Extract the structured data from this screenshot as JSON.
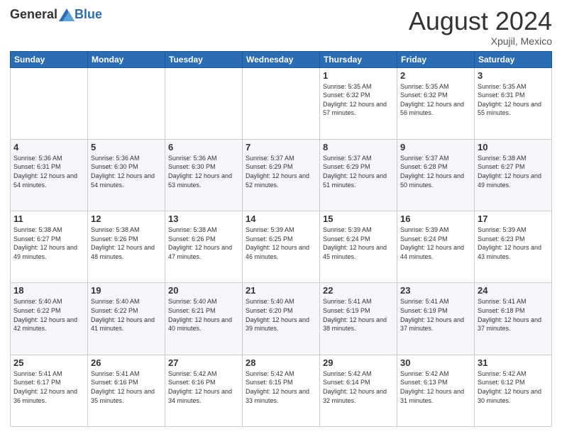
{
  "logo": {
    "general": "General",
    "blue": "Blue"
  },
  "title": "August 2024",
  "location": "Xpujil, Mexico",
  "days_of_week": [
    "Sunday",
    "Monday",
    "Tuesday",
    "Wednesday",
    "Thursday",
    "Friday",
    "Saturday"
  ],
  "weeks": [
    [
      {
        "day": "",
        "info": ""
      },
      {
        "day": "",
        "info": ""
      },
      {
        "day": "",
        "info": ""
      },
      {
        "day": "",
        "info": ""
      },
      {
        "day": "1",
        "info": "Sunrise: 5:35 AM\nSunset: 6:32 PM\nDaylight: 12 hours\nand 57 minutes."
      },
      {
        "day": "2",
        "info": "Sunrise: 5:35 AM\nSunset: 6:32 PM\nDaylight: 12 hours\nand 56 minutes."
      },
      {
        "day": "3",
        "info": "Sunrise: 5:35 AM\nSunset: 6:31 PM\nDaylight: 12 hours\nand 55 minutes."
      }
    ],
    [
      {
        "day": "4",
        "info": "Sunrise: 5:36 AM\nSunset: 6:31 PM\nDaylight: 12 hours\nand 54 minutes."
      },
      {
        "day": "5",
        "info": "Sunrise: 5:36 AM\nSunset: 6:30 PM\nDaylight: 12 hours\nand 54 minutes."
      },
      {
        "day": "6",
        "info": "Sunrise: 5:36 AM\nSunset: 6:30 PM\nDaylight: 12 hours\nand 53 minutes."
      },
      {
        "day": "7",
        "info": "Sunrise: 5:37 AM\nSunset: 6:29 PM\nDaylight: 12 hours\nand 52 minutes."
      },
      {
        "day": "8",
        "info": "Sunrise: 5:37 AM\nSunset: 6:29 PM\nDaylight: 12 hours\nand 51 minutes."
      },
      {
        "day": "9",
        "info": "Sunrise: 5:37 AM\nSunset: 6:28 PM\nDaylight: 12 hours\nand 50 minutes."
      },
      {
        "day": "10",
        "info": "Sunrise: 5:38 AM\nSunset: 6:27 PM\nDaylight: 12 hours\nand 49 minutes."
      }
    ],
    [
      {
        "day": "11",
        "info": "Sunrise: 5:38 AM\nSunset: 6:27 PM\nDaylight: 12 hours\nand 49 minutes."
      },
      {
        "day": "12",
        "info": "Sunrise: 5:38 AM\nSunset: 6:26 PM\nDaylight: 12 hours\nand 48 minutes."
      },
      {
        "day": "13",
        "info": "Sunrise: 5:38 AM\nSunset: 6:26 PM\nDaylight: 12 hours\nand 47 minutes."
      },
      {
        "day": "14",
        "info": "Sunrise: 5:39 AM\nSunset: 6:25 PM\nDaylight: 12 hours\nand 46 minutes."
      },
      {
        "day": "15",
        "info": "Sunrise: 5:39 AM\nSunset: 6:24 PM\nDaylight: 12 hours\nand 45 minutes."
      },
      {
        "day": "16",
        "info": "Sunrise: 5:39 AM\nSunset: 6:24 PM\nDaylight: 12 hours\nand 44 minutes."
      },
      {
        "day": "17",
        "info": "Sunrise: 5:39 AM\nSunset: 6:23 PM\nDaylight: 12 hours\nand 43 minutes."
      }
    ],
    [
      {
        "day": "18",
        "info": "Sunrise: 5:40 AM\nSunset: 6:22 PM\nDaylight: 12 hours\nand 42 minutes."
      },
      {
        "day": "19",
        "info": "Sunrise: 5:40 AM\nSunset: 6:22 PM\nDaylight: 12 hours\nand 41 minutes."
      },
      {
        "day": "20",
        "info": "Sunrise: 5:40 AM\nSunset: 6:21 PM\nDaylight: 12 hours\nand 40 minutes."
      },
      {
        "day": "21",
        "info": "Sunrise: 5:40 AM\nSunset: 6:20 PM\nDaylight: 12 hours\nand 39 minutes."
      },
      {
        "day": "22",
        "info": "Sunrise: 5:41 AM\nSunset: 6:19 PM\nDaylight: 12 hours\nand 38 minutes."
      },
      {
        "day": "23",
        "info": "Sunrise: 5:41 AM\nSunset: 6:19 PM\nDaylight: 12 hours\nand 37 minutes."
      },
      {
        "day": "24",
        "info": "Sunrise: 5:41 AM\nSunset: 6:18 PM\nDaylight: 12 hours\nand 37 minutes."
      }
    ],
    [
      {
        "day": "25",
        "info": "Sunrise: 5:41 AM\nSunset: 6:17 PM\nDaylight: 12 hours\nand 36 minutes."
      },
      {
        "day": "26",
        "info": "Sunrise: 5:41 AM\nSunset: 6:16 PM\nDaylight: 12 hours\nand 35 minutes."
      },
      {
        "day": "27",
        "info": "Sunrise: 5:42 AM\nSunset: 6:16 PM\nDaylight: 12 hours\nand 34 minutes."
      },
      {
        "day": "28",
        "info": "Sunrise: 5:42 AM\nSunset: 6:15 PM\nDaylight: 12 hours\nand 33 minutes."
      },
      {
        "day": "29",
        "info": "Sunrise: 5:42 AM\nSunset: 6:14 PM\nDaylight: 12 hours\nand 32 minutes."
      },
      {
        "day": "30",
        "info": "Sunrise: 5:42 AM\nSunset: 6:13 PM\nDaylight: 12 hours\nand 31 minutes."
      },
      {
        "day": "31",
        "info": "Sunrise: 5:42 AM\nSunset: 6:12 PM\nDaylight: 12 hours\nand 30 minutes."
      }
    ]
  ]
}
